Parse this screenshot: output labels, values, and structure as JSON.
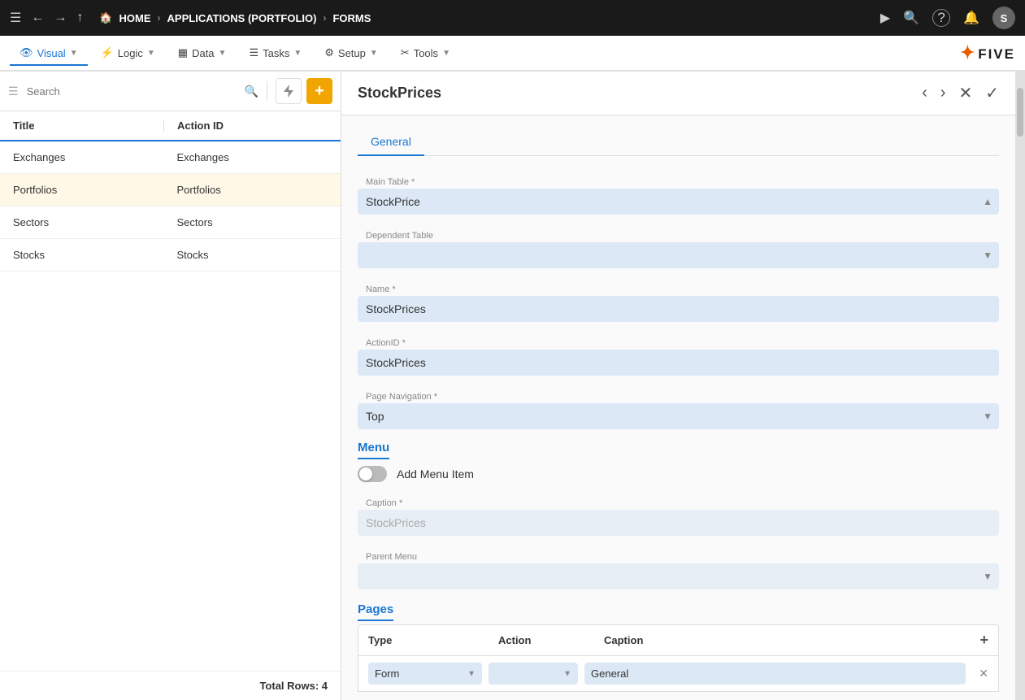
{
  "topBar": {
    "menuIcon": "☰",
    "backIcon": "←",
    "forwardIcon": "→",
    "upIcon": "↑",
    "homeLabel": "HOME",
    "arrow1": "›",
    "appLabel": "APPLICATIONS (PORTFOLIO)",
    "arrow2": "›",
    "formsLabel": "FORMS",
    "playIcon": "▶",
    "searchIcon": "🔍",
    "helpIcon": "?",
    "bellIcon": "🔔",
    "avatarLabel": "S"
  },
  "menuBar": {
    "items": [
      {
        "label": "Visual",
        "icon": "👁",
        "active": true
      },
      {
        "label": "Logic",
        "icon": "⚙",
        "active": false
      },
      {
        "label": "Data",
        "icon": "▦",
        "active": false
      },
      {
        "label": "Tasks",
        "icon": "☰",
        "active": false
      },
      {
        "label": "Setup",
        "icon": "⚙",
        "active": false
      },
      {
        "label": "Tools",
        "icon": "✂",
        "active": false
      }
    ],
    "logo": "FIVE"
  },
  "leftPanel": {
    "searchPlaceholder": "Search",
    "columns": {
      "title": "Title",
      "actionId": "Action ID"
    },
    "rows": [
      {
        "title": "Exchanges",
        "actionId": "Exchanges",
        "selected": false
      },
      {
        "title": "Portfolios",
        "actionId": "Portfolios",
        "selected": true
      },
      {
        "title": "Sectors",
        "actionId": "Sectors",
        "selected": false
      },
      {
        "title": "Stocks",
        "actionId": "Stocks",
        "selected": false
      }
    ],
    "totalRows": "Total Rows: 4"
  },
  "rightPanel": {
    "title": "StockPrices",
    "tabs": {
      "general": "General",
      "menu": "Menu",
      "pages": "Pages"
    },
    "general": {
      "mainTableLabel": "Main Table *",
      "mainTableValue": "StockPrice",
      "dependentTableLabel": "Dependent Table",
      "dependentTableValue": "",
      "nameLabel": "Name *",
      "nameValue": "StockPrices",
      "actionIdLabel": "ActionID *",
      "actionIdValue": "StockPrices",
      "pageNavigationLabel": "Page Navigation *",
      "pageNavigationValue": "Top"
    },
    "menu": {
      "sectionLabel": "Menu",
      "toggleLabel": "Add Menu Item",
      "captionLabel": "Caption *",
      "captionValue": "StockPrices",
      "parentMenuLabel": "Parent Menu",
      "parentMenuValue": ""
    },
    "pages": {
      "sectionLabel": "Pages",
      "columns": {
        "type": "Type",
        "action": "Action",
        "caption": "Caption"
      },
      "rows": [
        {
          "type": "Form",
          "action": "",
          "caption": "General"
        }
      ]
    }
  }
}
